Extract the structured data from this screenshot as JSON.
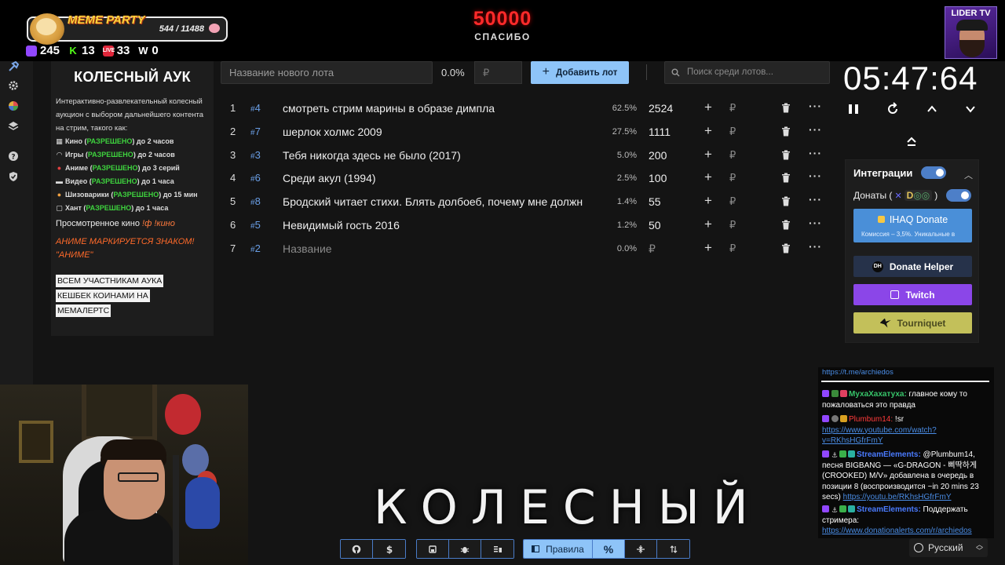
{
  "overlay": {
    "meme_title": "MEME PARTY",
    "meme_count": "544 / 11488",
    "stats": [
      {
        "icon": "twitch-icon",
        "value": "245"
      },
      {
        "icon": "kick-icon",
        "value": "13"
      },
      {
        "icon": "live-icon",
        "value": "33"
      },
      {
        "icon": "w-icon",
        "value": "0"
      }
    ],
    "donation_amount": "50000",
    "donation_thanks": "СПАСИБО",
    "lider_label": "LIDER TV"
  },
  "description": {
    "title": "КОЛЕСНЫЙ АУК",
    "intro": "Интерактивно-развлекательный колесный аукцион с выбором дальнейшего контента на стрим, такого как:",
    "rules": [
      {
        "name": "Кино",
        "status": "РАЗРЕШЕНО",
        "limit": "до 2 часов"
      },
      {
        "name": "Игры",
        "status": "РАЗРЕШЕНО",
        "limit": "до 2 часов"
      },
      {
        "name": "Аниме",
        "status": "РАЗРЕШЕНО",
        "limit": "до 3 серий"
      },
      {
        "name": "Видео",
        "status": "РАЗРЕШЕНО",
        "limit": "до 1 часа"
      },
      {
        "name": "Шизоварики",
        "status": "РАЗРЕШЕНО",
        "limit": "до 15 мин"
      },
      {
        "name": "Хант",
        "status": "РАЗРЕШЕНО",
        "limit": "до 1 часа"
      }
    ],
    "watched_label": "Просмотренное кино",
    "watched_cmd": "!ф !кино",
    "anime_note_1": "АНИМЕ МАРКИРУЕТСЯ ЗНАКОМ!",
    "anime_note_2": "\"АНИМЕ\"",
    "cashback": [
      "ВСЕМ УЧАСТНИКАМ АУКА",
      "КЕШБЕК КОИНАМИ НА",
      "МЕМАЛЕРТС"
    ]
  },
  "lot_form": {
    "name_placeholder": "Название нового лота",
    "percent": "0.0%",
    "rub_placeholder": "₽",
    "add_label": "Добавить лот",
    "search_placeholder": "Поиск среди лотов..."
  },
  "lots": [
    {
      "idx": "1",
      "id": "4",
      "name": "смотреть стрим марины в образе димпла",
      "pct": "62.5%",
      "amount": "2524"
    },
    {
      "idx": "2",
      "id": "7",
      "name": "шерлок холмс 2009",
      "pct": "27.5%",
      "amount": "1111"
    },
    {
      "idx": "3",
      "id": "3",
      "name": "Тебя никогда здесь не было (2017)",
      "pct": "5.0%",
      "amount": "200"
    },
    {
      "idx": "4",
      "id": "6",
      "name": "Среди акул (1994)",
      "pct": "2.5%",
      "amount": "100"
    },
    {
      "idx": "5",
      "id": "8",
      "name": "Бродский читает стихи. Блять долбоеб, почему мне должн",
      "pct": "1.4%",
      "amount": "55"
    },
    {
      "idx": "6",
      "id": "5",
      "name": "Невидимый гость 2016",
      "pct": "1.2%",
      "amount": "50"
    },
    {
      "idx": "7",
      "id": "2",
      "name": "Название",
      "pct": "0.0%",
      "amount": "₽"
    }
  ],
  "lot_row_symbols": {
    "hash": "#",
    "add": "+",
    "rub": "₽",
    "more": "···"
  },
  "timer": {
    "value": "05:47:64"
  },
  "integrations": {
    "title": "Интеграции",
    "donates_label": "Донаты (",
    "donates_x": "✕",
    "donates_logo_d": "D",
    "donates_logo_rest": "◎◎",
    "donates_close": ")",
    "ihaq_title": "IHAQ Donate",
    "ihaq_sub": "Комиссия – 3,5%. Уникальные в",
    "donate_helper": "Donate Helper",
    "donate_helper_glyph": "DH",
    "twitch": "Twitch",
    "tourniquet": "Tourniquet"
  },
  "chat": {
    "top_link": "https://t.me/archiedos",
    "messages": [
      {
        "user": "МухаХахатуха:",
        "text": " главное кому то пожаловаться это правда"
      },
      {
        "user": "Plumbum14:",
        "text": " !sr ",
        "link": "https://www.youtube.com/watch?v=RKhsHGfrFmY"
      },
      {
        "user": "StreamElements:",
        "text": " @Plumbum14, песня BIGBANG — «G-DRAGON - 삐딱하게 (CROOKED) M/V» добавлена в очередь в позиции 8 (воспроизводится ~in 20 mins 23 secs) ",
        "link": "https://youtu.be/RKhsHGfrFmY"
      },
      {
        "user": "StreamElements:",
        "text": " Поддержать стримера: ",
        "link": "https://www.donationalerts.com/r/archiedos"
      }
    ]
  },
  "caption": "КОЛЕСНЫЙ",
  "toolbar": {
    "rules_label": "Правила",
    "percent_label": "%"
  },
  "language": {
    "label": "Русский"
  },
  "colors": {
    "accent_blue": "#8ec4f8",
    "allowed_green": "#3ed33e",
    "note_orange": "#ff6a2a",
    "donation_red": "#ff2a2a",
    "twitch_purple": "#8b46e8"
  }
}
